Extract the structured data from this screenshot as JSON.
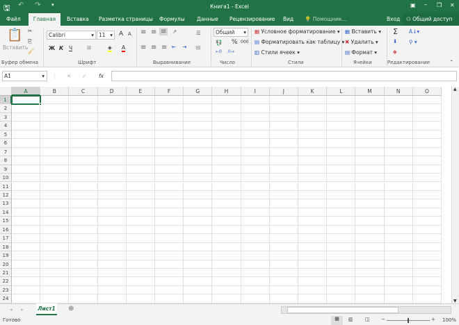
{
  "window": {
    "title": "Книга1 - Excel",
    "minimize": "–",
    "restore": "❐",
    "close": "✕"
  },
  "quick_access": {
    "save_icon": "save-icon",
    "undo": "↶",
    "redo": "↷"
  },
  "tabs": [
    {
      "label": "Файл"
    },
    {
      "label": "Главная"
    },
    {
      "label": "Вставка"
    },
    {
      "label": "Разметка страницы"
    },
    {
      "label": "Формулы"
    },
    {
      "label": "Данные"
    },
    {
      "label": "Рецензирование"
    },
    {
      "label": "Вид"
    },
    {
      "label": "Помощник..."
    }
  ],
  "account": {
    "login": "Вход",
    "share": "Общий доступ"
  },
  "ribbon": {
    "clipboard": {
      "label": "Буфер обмена",
      "paste": "Вставить"
    },
    "font": {
      "label": "Шрифт",
      "name": "Calibri",
      "size": "11",
      "bold": "Ж",
      "italic": "К",
      "underline": "Ч",
      "grow": "A",
      "shrink": "A",
      "color": "A"
    },
    "alignment": {
      "label": "Выравнивание"
    },
    "number": {
      "label": "Число",
      "format": "Общий",
      "percent": "%",
      "thousands": "000"
    },
    "styles": {
      "label": "Стили",
      "conditional": "Условное форматирование",
      "as_table": "Форматировать как таблицу",
      "cell_styles": "Стили ячеек"
    },
    "cells": {
      "label": "Ячейки",
      "insert": "Вставить",
      "delete": "Удалить",
      "format": "Формат"
    },
    "editing": {
      "label": "Редактирование",
      "sum": "Σ"
    }
  },
  "formula_bar": {
    "name_box": "A1",
    "cancel": "✕",
    "enter": "✓",
    "fx": "fx",
    "value": ""
  },
  "grid": {
    "columns": [
      "A",
      "B",
      "C",
      "D",
      "E",
      "F",
      "G",
      "H",
      "I",
      "J",
      "K",
      "L",
      "M",
      "N",
      "O"
    ],
    "rows": [
      "1",
      "2",
      "3",
      "4",
      "5",
      "6",
      "7",
      "8",
      "9",
      "10",
      "11",
      "12",
      "13",
      "14",
      "15",
      "16",
      "17",
      "18",
      "19",
      "20",
      "21",
      "22",
      "23",
      "24"
    ],
    "selected_cell": "A1"
  },
  "sheets": [
    {
      "label": "Лист1",
      "active": true
    }
  ],
  "status": {
    "ready": "Готово",
    "zoom": "100%",
    "zoom_percent": 100
  },
  "colors": {
    "accent": "#217346"
  }
}
